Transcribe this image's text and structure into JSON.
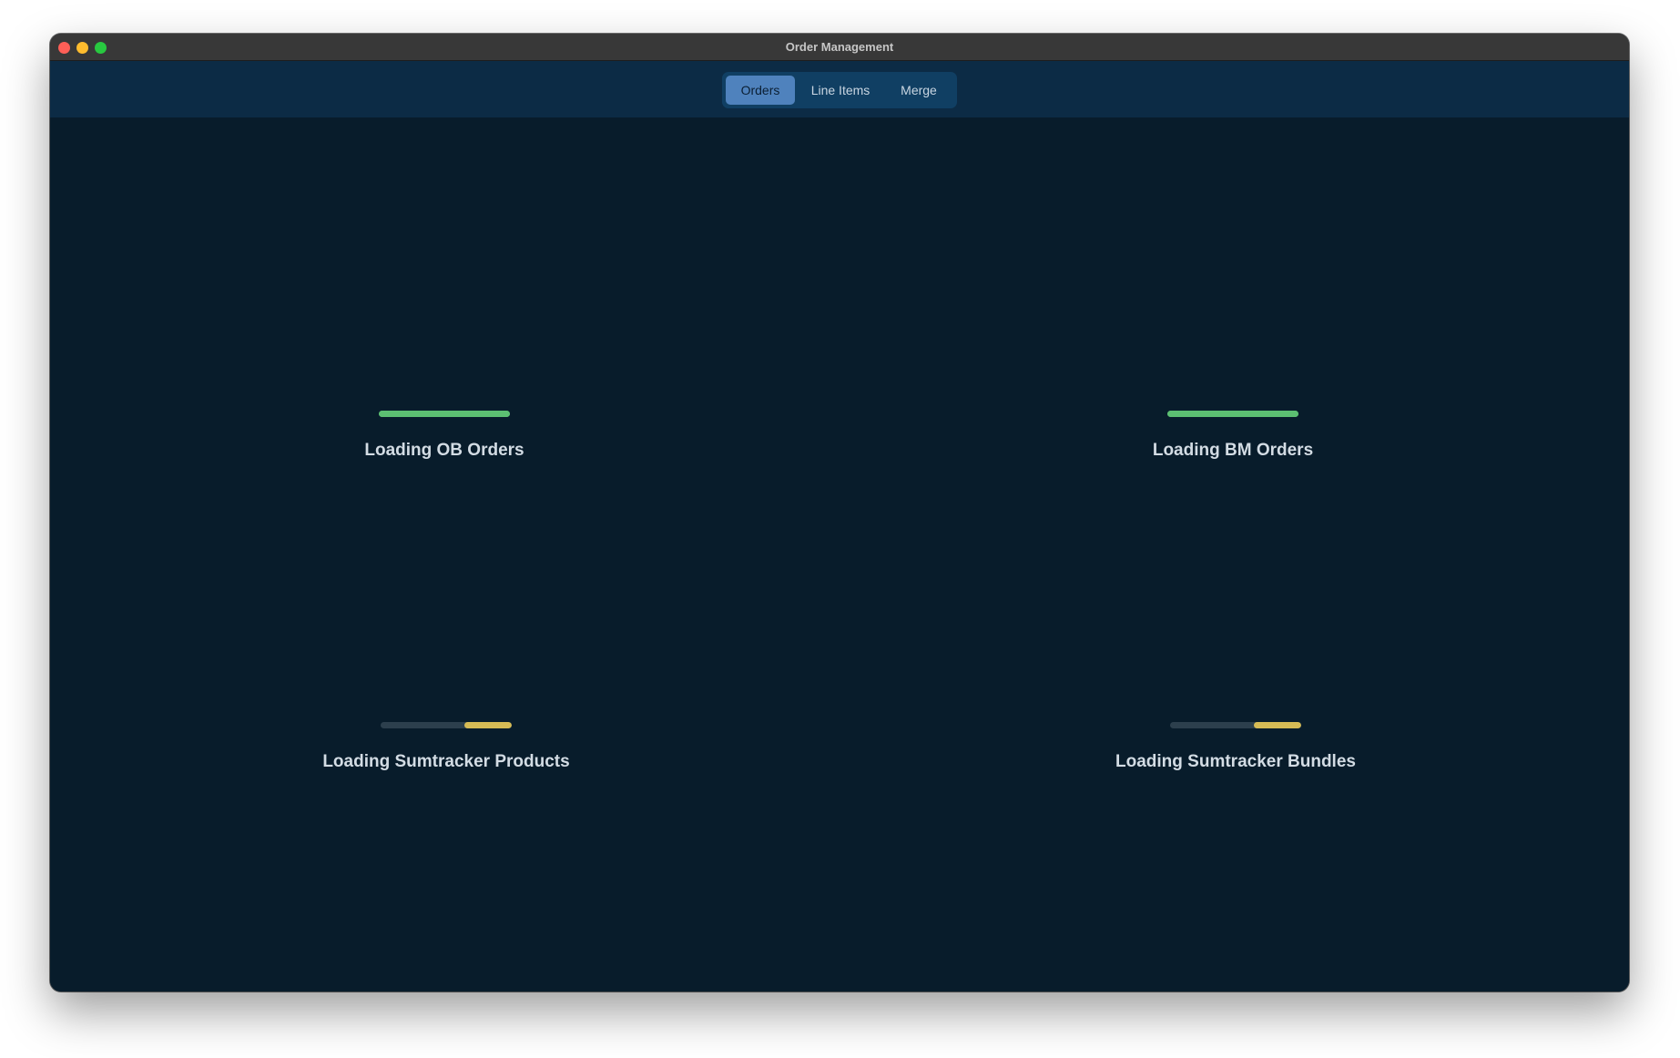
{
  "window": {
    "title": "Order Management"
  },
  "toolbar": {
    "tabs": [
      {
        "label": "Orders",
        "active": true
      },
      {
        "label": "Line Items",
        "active": false
      },
      {
        "label": "Merge",
        "active": false
      }
    ]
  },
  "colors": {
    "close": "#fe5f57",
    "minimize": "#febc2e",
    "maximize": "#28c840",
    "complete": "#5cbf72",
    "pending": "#d6bb55",
    "track": "#2c3f4d"
  },
  "loaders": [
    {
      "label": "Loading OB Orders",
      "state": "complete",
      "progress_start": 0.0,
      "progress_end": 1.0
    },
    {
      "label": "Loading BM Orders",
      "state": "complete",
      "progress_start": 0.0,
      "progress_end": 1.0
    },
    {
      "label": "Loading Sumtracker Products",
      "state": "in-progress",
      "progress_start": 0.64,
      "progress_end": 1.0
    },
    {
      "label": "Loading Sumtracker Bundles",
      "state": "in-progress",
      "progress_start": 0.64,
      "progress_end": 1.0
    }
  ]
}
